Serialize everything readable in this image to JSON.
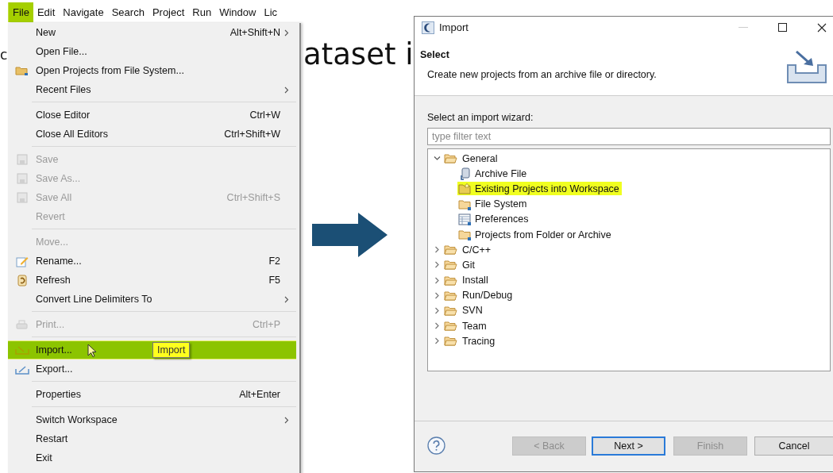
{
  "background_text": [
    {
      "text": "c"
    },
    {
      "text": "ataset i"
    }
  ],
  "menubar": [
    {
      "label": "File",
      "selected": true
    },
    {
      "label": "Edit",
      "selected": false
    },
    {
      "label": "Navigate",
      "selected": false
    },
    {
      "label": "Search",
      "selected": false
    },
    {
      "label": "Project",
      "selected": false
    },
    {
      "label": "Run",
      "selected": false
    },
    {
      "label": "Window",
      "selected": false
    },
    {
      "label": "Lic",
      "selected": false
    }
  ],
  "file_menu": [
    [
      {
        "label": "New",
        "shortcut": "Alt+Shift+N",
        "submenu": true,
        "disabled": false,
        "selected": false
      },
      {
        "label": "Open File...",
        "disabled": false,
        "selected": false
      },
      {
        "label": "Open Projects from File System...",
        "kind": "folder",
        "disabled": false,
        "selected": false
      },
      {
        "label": "Recent Files",
        "submenu": true,
        "disabled": false,
        "selected": false
      }
    ],
    [
      {
        "label": "Close Editor",
        "shortcut": "Ctrl+W",
        "disabled": false,
        "selected": false
      },
      {
        "label": "Close All Editors",
        "shortcut": "Ctrl+Shift+W",
        "disabled": false,
        "selected": false
      }
    ],
    [
      {
        "label": "Save",
        "kind": "save",
        "disabled": true,
        "selected": false
      },
      {
        "label": "Save As...",
        "kind": "save",
        "disabled": true,
        "selected": false
      },
      {
        "label": "Save All",
        "shortcut": "Ctrl+Shift+S",
        "kind": "save",
        "disabled": true,
        "selected": false
      },
      {
        "label": "Revert",
        "disabled": true,
        "selected": false
      }
    ],
    [
      {
        "label": "Move...",
        "disabled": true,
        "selected": false
      },
      {
        "label": "Rename...",
        "shortcut": "F2",
        "kind": "rename",
        "disabled": false,
        "selected": false
      },
      {
        "label": "Refresh",
        "shortcut": "F5",
        "kind": "refresh",
        "disabled": false,
        "selected": false
      },
      {
        "label": "Convert Line Delimiters To",
        "submenu": true,
        "disabled": false,
        "selected": false
      }
    ],
    [
      {
        "label": "Print...",
        "shortcut": "Ctrl+P",
        "kind": "print",
        "disabled": true,
        "selected": false
      }
    ],
    [
      {
        "label": "Import...",
        "kind": "import",
        "disabled": false,
        "selected": true
      },
      {
        "label": "Export...",
        "kind": "export",
        "disabled": false,
        "selected": false
      }
    ],
    [
      {
        "label": "Properties",
        "shortcut": "Alt+Enter",
        "disabled": false,
        "selected": false
      }
    ],
    [
      {
        "label": "Switch Workspace",
        "submenu": true,
        "disabled": false,
        "selected": false
      },
      {
        "label": "Restart",
        "disabled": false,
        "selected": false
      },
      {
        "label": "Exit",
        "disabled": false,
        "selected": false
      }
    ]
  ],
  "tooltip": "Import",
  "dialog": {
    "title": "Import",
    "heading": "Select",
    "description": "Create new projects from an archive file or directory.",
    "wizard_label": "Select an import wizard:",
    "filter": {
      "placeholder": "type filter text"
    },
    "tree": [
      {
        "label": "General",
        "expanded": true,
        "selected": false,
        "children": [
          {
            "label": "Archive File",
            "kind": "archive",
            "selected": false
          },
          {
            "label": "Existing Projects into Workspace",
            "kind": "project",
            "selected": true
          },
          {
            "label": "File System",
            "kind": "folder",
            "selected": false
          },
          {
            "label": "Preferences",
            "kind": "preferences",
            "selected": false
          },
          {
            "label": "Projects from Folder or Archive",
            "kind": "folder",
            "selected": false
          }
        ]
      },
      {
        "label": "C/C++",
        "expanded": false,
        "selected": false
      },
      {
        "label": "Git",
        "expanded": false,
        "selected": false
      },
      {
        "label": "Install",
        "expanded": false,
        "selected": false
      },
      {
        "label": "Run/Debug",
        "expanded": false,
        "selected": false
      },
      {
        "label": "SVN",
        "expanded": false,
        "selected": false
      },
      {
        "label": "Team",
        "expanded": false,
        "selected": false
      },
      {
        "label": "Tracing",
        "expanded": false,
        "selected": false
      }
    ],
    "buttons": [
      {
        "label": "< Back",
        "disabled": true,
        "focused": false
      },
      {
        "label": "Next >",
        "disabled": false,
        "focused": true
      },
      {
        "label": "Finish",
        "disabled": true,
        "focused": false
      },
      {
        "label": "Cancel",
        "disabled": false,
        "focused": false
      }
    ]
  }
}
